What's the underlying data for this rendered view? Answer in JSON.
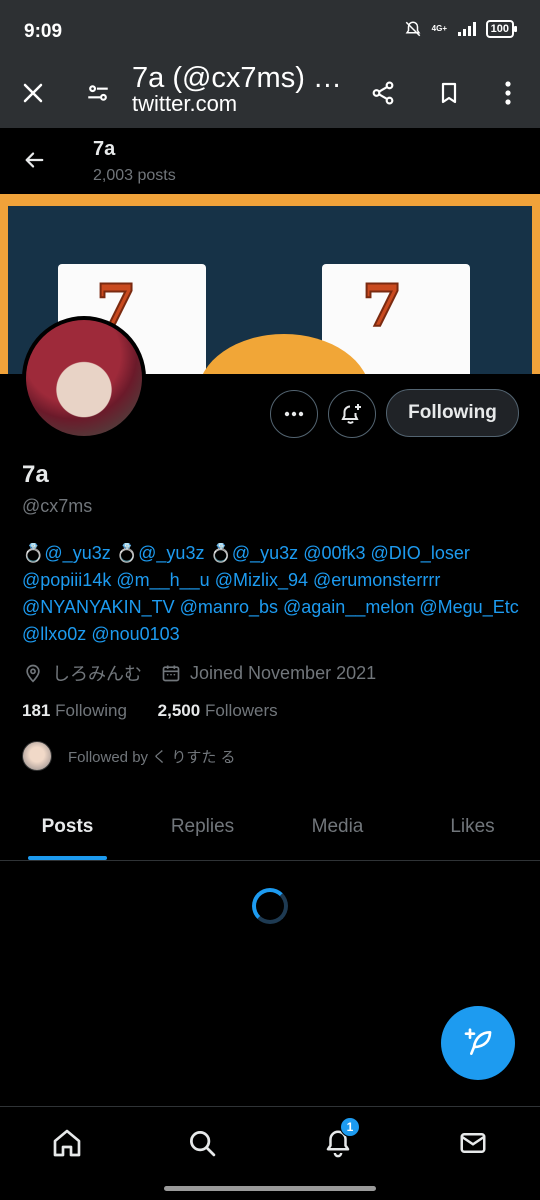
{
  "status": {
    "time": "9:09",
    "network": "4G+",
    "battery": "100"
  },
  "browser": {
    "title": "7a (@cx7ms) …",
    "url": "twitter.com"
  },
  "header": {
    "name": "7a",
    "posts": "2,003 posts"
  },
  "profile": {
    "name": "7a",
    "handle": "@cx7ms",
    "following_button": "Following",
    "bio": [
      "💍@_yu3z",
      "💍@_yu3z",
      "💍@_yu3z",
      "@00fk3",
      "@DIO_loser",
      "@popiii14k",
      "@m__h__u",
      "@Mizlix_94",
      "@erumonsterrrr",
      "@NYANYAKIN_TV",
      "@manro_bs",
      "@again__melon",
      "@Megu_Etc",
      "@llxo0z",
      "@nou0103"
    ],
    "location": "しろみんむ",
    "joined": "Joined November 2021",
    "following_count": "181",
    "following_label": "Following",
    "followers_count": "2,500",
    "followers_label": "Followers",
    "followed_by": "Followed by く りすた る"
  },
  "banner_text": {
    "seven_left": "7",
    "seven_right": "7"
  },
  "tabs": [
    "Posts",
    "Replies",
    "Media",
    "Likes"
  ],
  "notifications_badge": "1",
  "colors": {
    "accent": "#1d9bf0",
    "background": "#000000",
    "muted": "#71767b"
  }
}
